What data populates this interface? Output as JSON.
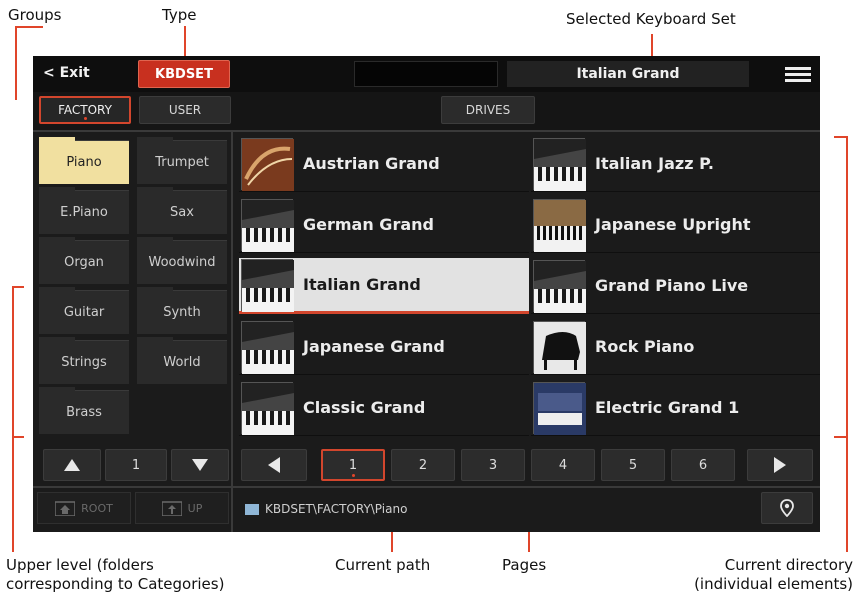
{
  "annotations": {
    "groups": "Groups",
    "type": "Type",
    "selected_set": "Selected Keyboard Set",
    "upper_level_1": "Upper level (folders",
    "upper_level_2": "corresponding to Categories)",
    "current_path": "Current path",
    "pages": "Pages",
    "current_dir_1": "Current directory",
    "current_dir_2": "(individual elements)"
  },
  "topbar": {
    "exit_label": "< Exit",
    "type_label": "KBDSET",
    "selected_set": "Italian Grand",
    "menu_icon": "menu-icon"
  },
  "tabs": {
    "factory": "FACTORY",
    "user": "USER",
    "drives": "DRIVES"
  },
  "categories": [
    {
      "label": "Piano",
      "selected": true
    },
    {
      "label": "Trumpet"
    },
    {
      "label": "E.Piano"
    },
    {
      "label": "Sax"
    },
    {
      "label": "Organ"
    },
    {
      "label": "Woodwind"
    },
    {
      "label": "Guitar"
    },
    {
      "label": "Synth"
    },
    {
      "label": "Strings"
    },
    {
      "label": "World"
    },
    {
      "label": "Brass"
    }
  ],
  "items": [
    {
      "label": "Austrian Grand"
    },
    {
      "label": "Italian Jazz P."
    },
    {
      "label": "German Grand"
    },
    {
      "label": "Japanese Upright"
    },
    {
      "label": "Italian Grand",
      "selected": true
    },
    {
      "label": "Grand Piano Live"
    },
    {
      "label": "Japanese Grand"
    },
    {
      "label": "Rock Piano"
    },
    {
      "label": "Classic Grand"
    },
    {
      "label": "Electric Grand 1"
    }
  ],
  "category_pager": {
    "value": "1",
    "up_icon": "triangle-up-icon",
    "down_icon": "triangle-down-icon"
  },
  "pages": [
    "1",
    "2",
    "3",
    "4",
    "5",
    "6"
  ],
  "page_nav": {
    "prev_icon": "triangle-left-icon",
    "next_icon": "triangle-right-icon"
  },
  "bottom": {
    "root_label": "ROOT",
    "up_label": "UP",
    "path": "KBDSET\\FACTORY\\Piano",
    "locate_icon": "location-pin-icon"
  },
  "colors": {
    "accent": "#d2462d",
    "selected_category": "#f1e0a0",
    "type_button": "#c8301f"
  }
}
